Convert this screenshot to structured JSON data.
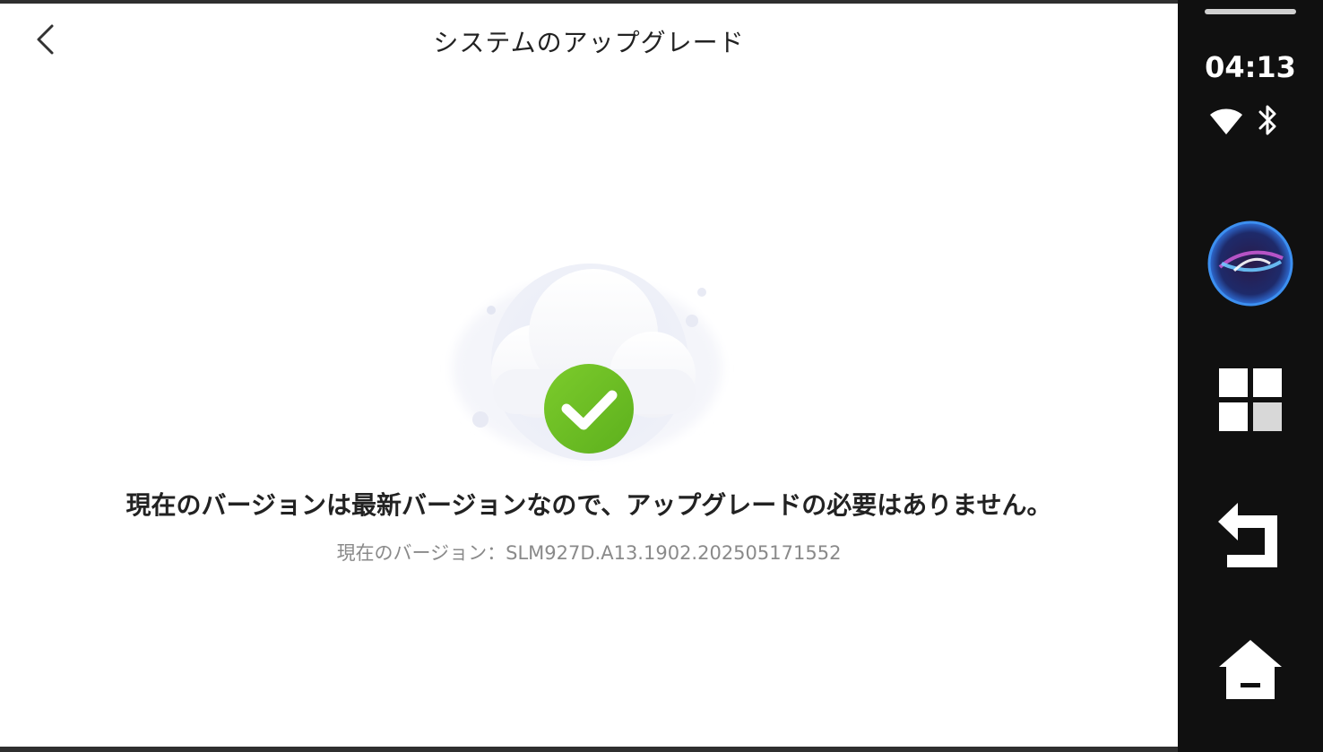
{
  "header": {
    "title": "システムのアップグレード"
  },
  "main": {
    "message": "現在のバージョンは最新バージョンなので、アップグレードの必要はありません。",
    "version_text": "現在のバージョン：SLM927D.A13.1902.202505171552"
  },
  "status_bar": {
    "time": "04:13",
    "icons": [
      "wifi-icon",
      "bluetooth-icon"
    ]
  },
  "sidebar": {
    "buttons": [
      "voice-assistant-icon",
      "apps-grid-icon",
      "back-icon",
      "home-icon"
    ]
  },
  "colors": {
    "accent_green": "#6cc024",
    "sidebar_bg": "#101010",
    "text_dark": "#222222",
    "text_muted": "#8a8a8a"
  }
}
